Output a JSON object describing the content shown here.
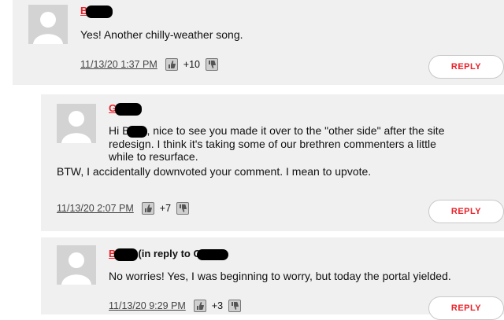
{
  "comments": [
    {
      "author_initial": "B",
      "reply_prefix": "",
      "body": [
        "Yes! Another chilly-weather song."
      ],
      "timestamp": "11/13/20 1:37 PM",
      "votes": "+10",
      "reply_label": "REPLY"
    },
    {
      "author_initial": "G",
      "reply_prefix": "",
      "body_line1a": "Hi B",
      "body_line1b": ", nice to see you made it over to the \"other side\" after the site",
      "body_line2": "redesign. I think it's taking some of our brethren commenters a little",
      "body_line3": "while to resurface.",
      "body_line4": "BTW, I accidentally downvoted your comment. I mean to upvote.",
      "timestamp": "11/13/20 2:07 PM",
      "votes": "+7",
      "reply_label": "REPLY"
    },
    {
      "author_initial": "B",
      "reply_prefix": "(in reply to G",
      "body": [
        "No worries! Yes, I was beginning to worry, but today the portal yielded."
      ],
      "timestamp": "11/13/20 9:29 PM",
      "votes": "+3",
      "reply_label": "REPLY"
    }
  ],
  "icons": {
    "avatar": "default-user-avatar",
    "upvote": "thumbs-up-icon",
    "downvote": "thumbs-down-icon"
  },
  "colors": {
    "accent": "#e8222a",
    "card_bg": "#f0f0f0",
    "avatar_bg": "#d3d3d3"
  }
}
